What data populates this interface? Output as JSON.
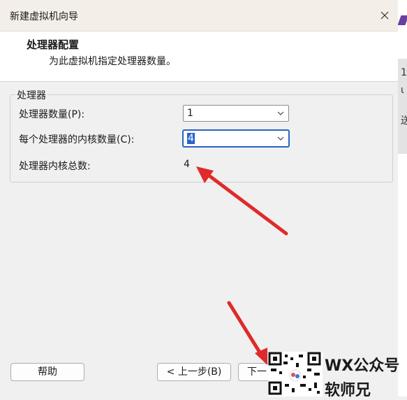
{
  "window": {
    "title": "新建虚拟机向导"
  },
  "header": {
    "title": "处理器配置",
    "subtitle": "为此虚拟机指定处理器数量。"
  },
  "group": {
    "legend": "处理器",
    "processor_count": {
      "label": "处理器数量(P):",
      "value": "1"
    },
    "cores_per_processor": {
      "label": "每个处理器的内核数量(C):",
      "value": "4"
    },
    "total_cores": {
      "label": "处理器内核总数:",
      "value": "4"
    }
  },
  "buttons": {
    "help": "帮助",
    "back": "< 上一步(B)",
    "next": "下一"
  },
  "watermark": {
    "line1": "WX公众号",
    "line2": "软师兄"
  },
  "background_app": {
    "glyph1": "1",
    "glyph2": "ι",
    "glyph3": "送"
  },
  "colors": {
    "accent": "#2a62c9",
    "annotation_arrow": "#e02a2a",
    "background_accent": "#6a3fa0"
  }
}
